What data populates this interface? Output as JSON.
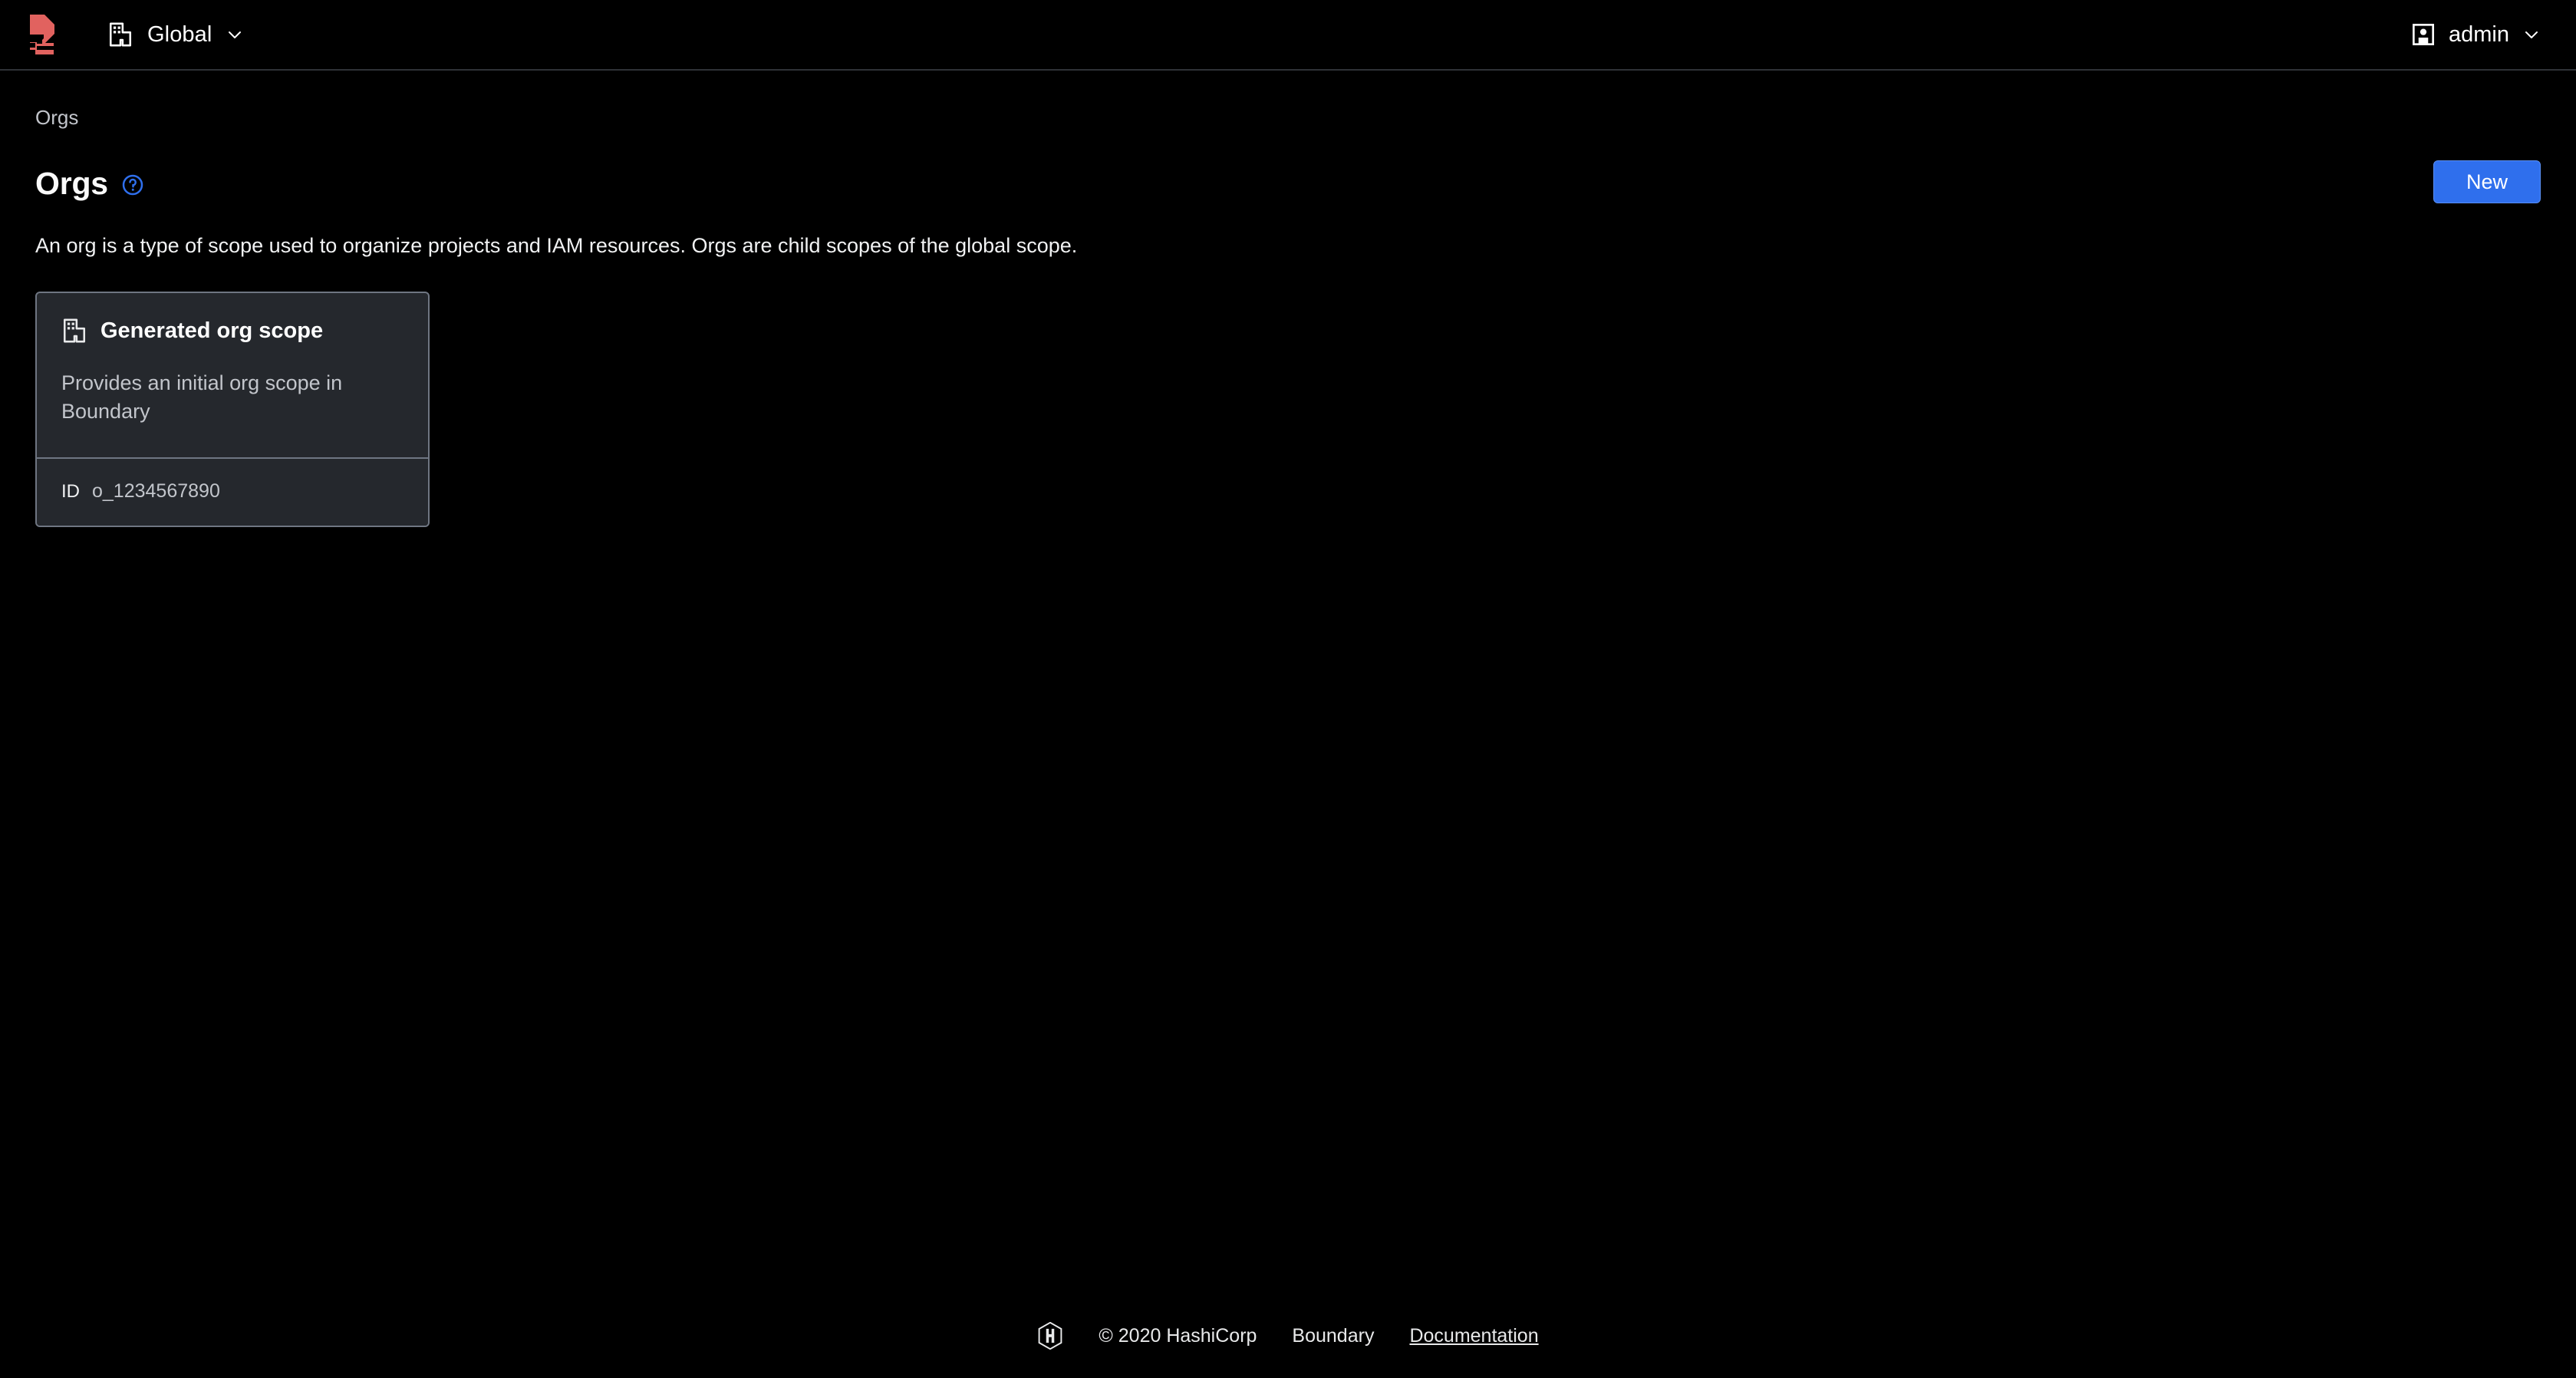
{
  "colors": {
    "background": "#000000",
    "brand_red": "#e1625f",
    "accent_blue": "#2f6fed",
    "card_bg": "#25282d",
    "card_border": "#6f7682",
    "muted_text": "#c2c5cb"
  },
  "topnav": {
    "logo_name": "boundary-logo",
    "scope": {
      "icon": "org-building-icon",
      "label": "Global",
      "chevron": "chevron-down-icon"
    },
    "user": {
      "icon": "user-avatar-icon",
      "label": "admin",
      "chevron": "chevron-down-icon"
    }
  },
  "breadcrumb": {
    "items": [
      {
        "label": "Orgs"
      }
    ]
  },
  "page": {
    "title": "Orgs",
    "help_icon": "help-circle-icon",
    "description": "An org is a type of scope used to organize projects and IAM resources. Orgs are child scopes of the global scope.",
    "new_button_label": "New"
  },
  "orgs": [
    {
      "icon": "org-building-icon",
      "title": "Generated org scope",
      "description": "Provides an initial org scope in Boundary",
      "id_label": "ID",
      "id_value": "o_1234567890"
    }
  ],
  "footer": {
    "logo_name": "hashicorp-logo",
    "copyright": "© 2020 HashiCorp",
    "product": "Boundary",
    "documentation_link": "Documentation"
  }
}
